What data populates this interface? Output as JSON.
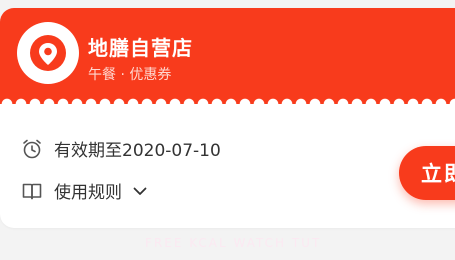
{
  "coupon": {
    "shop_name": "地膳自营店",
    "subtitle": "午餐 · 优惠券",
    "validity": "有效期至2020-07-10",
    "rules_label": "使用规则",
    "action_label": "立即"
  },
  "footer_faded": "FREE KCAL WATCH TUT",
  "colors": {
    "brand": "#f83b1c",
    "card": "#ffffff",
    "background": "#f3f3f3"
  },
  "icons": [
    "location-pin-icon",
    "alarm-clock-icon",
    "book-icon",
    "chevron-down-icon"
  ]
}
